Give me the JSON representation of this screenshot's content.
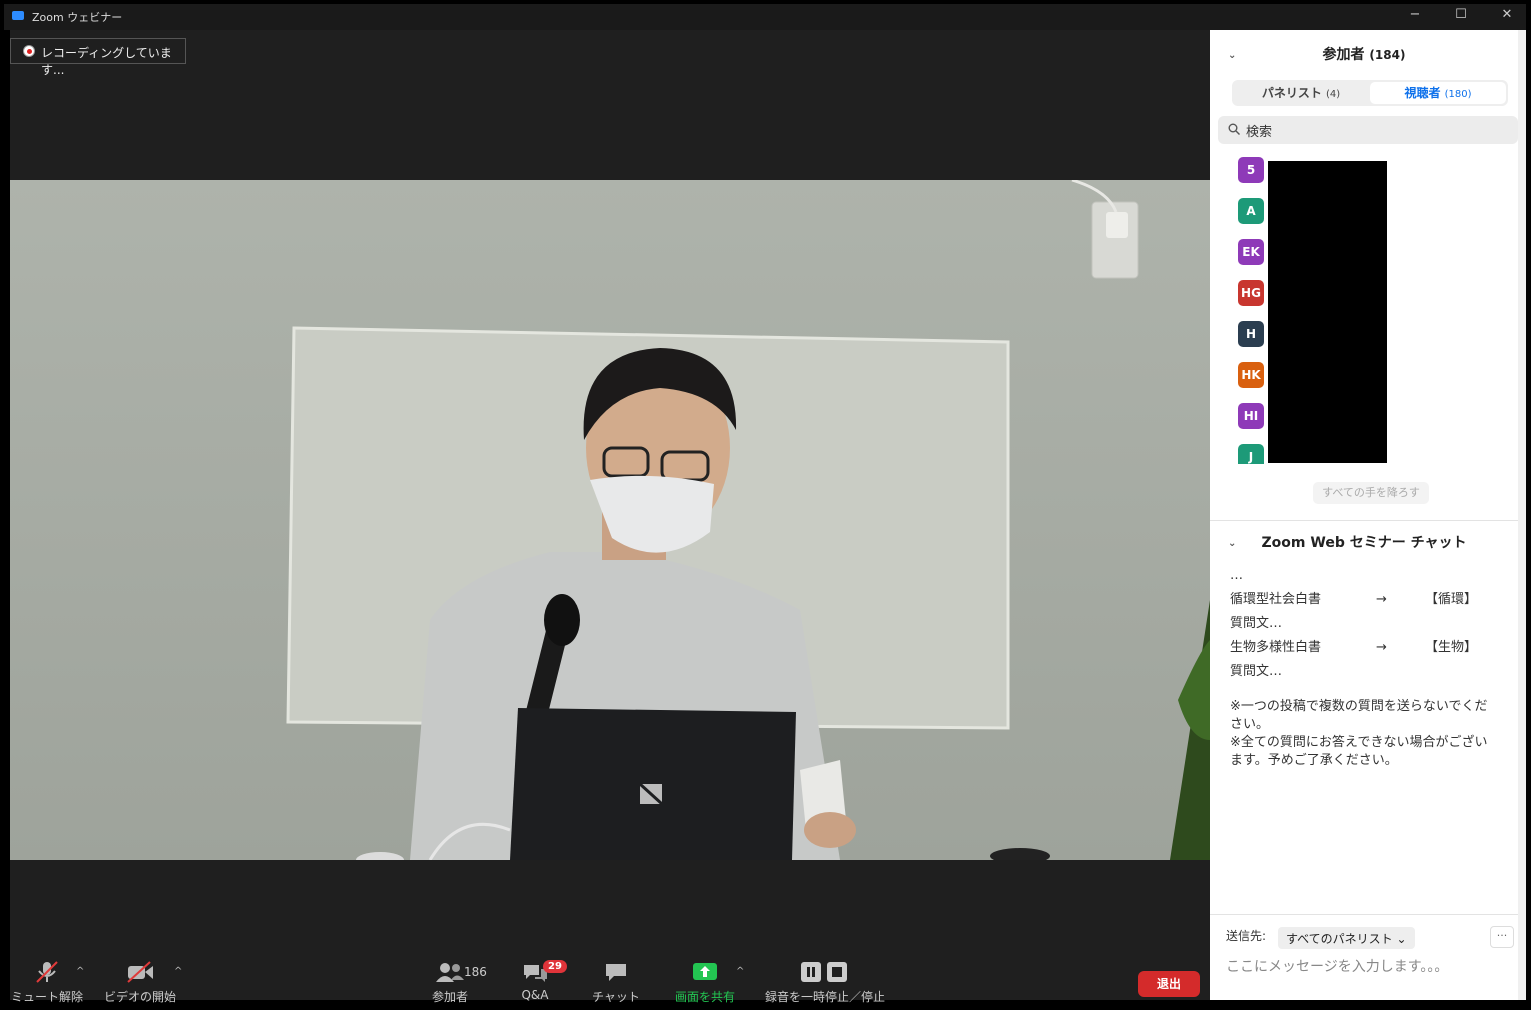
{
  "window": {
    "title": "Zoom ウェビナー",
    "minimize": "−",
    "maximize": "☐",
    "close": "✕"
  },
  "recording": {
    "label": "レコーディングしています..."
  },
  "toolbar": {
    "mute_label": "ミュート解除",
    "video_label": "ビデオの開始",
    "participants_label": "参加者",
    "participants_count": "186",
    "qa_label": "Q&A",
    "qa_count": "29",
    "chat_label": "チャット",
    "share_label": "画面を共有",
    "recording_label": "録音を一時停止／停止",
    "leave_label": "退出",
    "caret": "^"
  },
  "participants_panel": {
    "title": "参加者",
    "count": "(184)",
    "tabs": [
      {
        "label": "パネリスト",
        "count": "(4)"
      },
      {
        "label": "視聴者",
        "count": "(180)"
      }
    ],
    "search_placeholder": "検索",
    "attendees": [
      {
        "initials": "5",
        "color": "#8e3ab8"
      },
      {
        "initials": "A",
        "color": "#1d9a78"
      },
      {
        "initials": "EK",
        "color": "#8e3ab8"
      },
      {
        "initials": "HG",
        "color": "#c8362f"
      },
      {
        "initials": "H",
        "color": "#2b3e50"
      },
      {
        "initials": "HK",
        "color": "#d9600f"
      },
      {
        "initials": "HI",
        "color": "#8e3ab8"
      },
      {
        "initials": "J",
        "color": "#1d9a78"
      }
    ],
    "lower_all_hands": "すべての手を降ろす"
  },
  "chat_panel": {
    "title": "Zoom Web セミナー チャット",
    "ellipsis": "…",
    "lines": [
      {
        "left": "循環型社会白書",
        "arrow": "→",
        "tag": "【循環】"
      },
      {
        "left": "質問文…"
      },
      {
        "left": "生物多様性白書",
        "arrow": "→",
        "tag": "【生物】"
      },
      {
        "left": "質問文…"
      }
    ],
    "notes": [
      "※一つの投稿で複数の質問を送らないでください。",
      "※全ての質問にお答えできない場合がございます。予めご了承ください。"
    ],
    "send_to_label": "送信先:",
    "send_to_value": "すべてのパネリスト ⌄",
    "more": "···",
    "input_placeholder": "ここにメッセージを入力します。。。"
  }
}
